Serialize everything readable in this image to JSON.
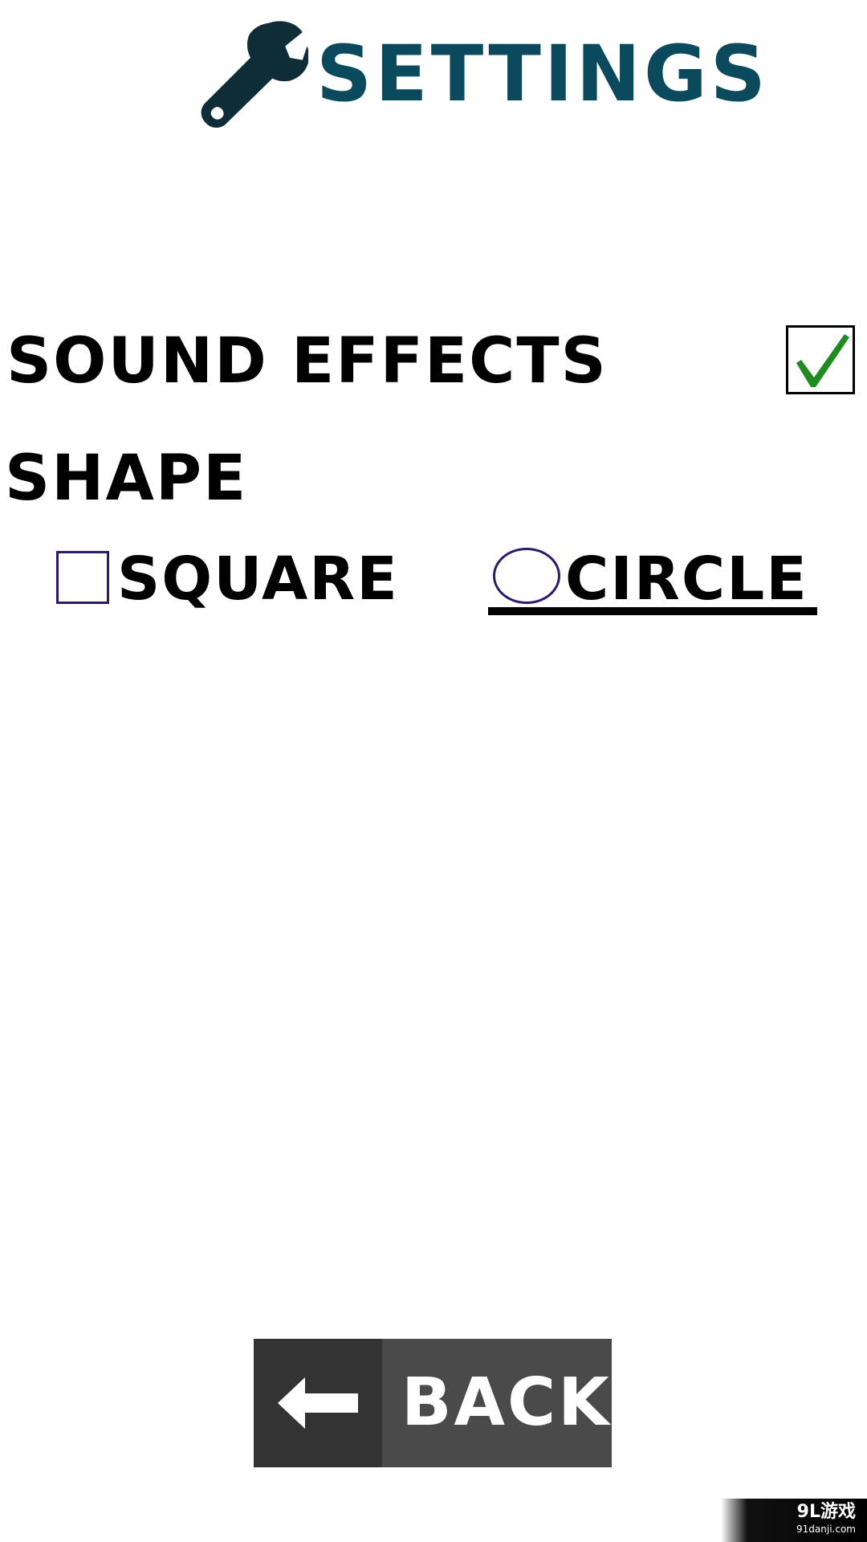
{
  "header": {
    "title": "SETTINGS",
    "icon": "wrench-icon",
    "title_color": "#0b4a5c"
  },
  "sound_effects": {
    "label": "SOUND EFFECTS",
    "checked": true,
    "check_color": "#1f8a1f"
  },
  "shape": {
    "label": "SHAPE",
    "selected": "circle",
    "options": [
      {
        "id": "square",
        "label": "SQUARE",
        "icon": "square-outline-icon"
      },
      {
        "id": "circle",
        "label": "CIRCLE",
        "icon": "circle-outline-icon"
      }
    ],
    "icon_color": "#2e1a6b"
  },
  "back_button": {
    "label": "BACK",
    "icon": "arrow-left-icon"
  },
  "watermark": {
    "title": "9L游戏",
    "subtitle": "91danji.com"
  }
}
